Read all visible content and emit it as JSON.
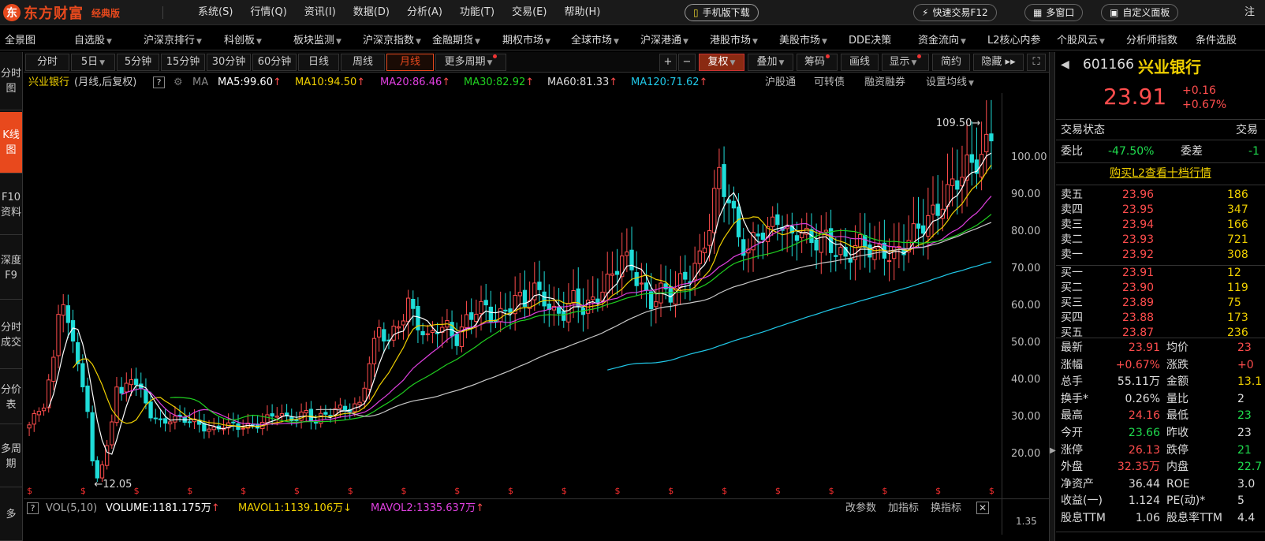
{
  "app": {
    "logo_text": "东方财富",
    "logo_sub": "经典版",
    "menu": [
      "系统(S)",
      "行情(Q)",
      "资讯(I)",
      "数据(D)",
      "分析(A)",
      "功能(T)",
      "交易(E)",
      "帮助(H)"
    ],
    "phone_btn": "手机版下载",
    "fast_trade_btn": "快速交易F12",
    "multi_window_btn": "多窗口",
    "custom_panel_btn": "自定义面板",
    "login": "注"
  },
  "nav": [
    {
      "label": "全景图",
      "dd": false
    },
    {
      "label": "自选股",
      "dd": true
    },
    {
      "label": "沪深京排行",
      "dd": true
    },
    {
      "label": "科创板",
      "dd": true
    },
    {
      "label": "板块监测",
      "dd": true
    },
    {
      "label": "沪深京指数",
      "dd": true
    },
    {
      "label": "金融期货",
      "dd": true
    },
    {
      "label": "期权市场",
      "dd": true
    },
    {
      "label": "全球市场",
      "dd": true
    },
    {
      "label": "沪深港通",
      "dd": true
    },
    {
      "label": "港股市场",
      "dd": true
    },
    {
      "label": "美股市场",
      "dd": true
    },
    {
      "label": "DDE决策",
      "dd": false
    },
    {
      "label": "资金流向",
      "dd": true
    },
    {
      "label": "L2核心内参",
      "dd": false
    },
    {
      "label": "个股风云",
      "dd": true
    },
    {
      "label": "分析师指数",
      "dd": false
    },
    {
      "label": "条件选股",
      "dd": false
    }
  ],
  "side_tabs": [
    {
      "label": "分时图",
      "active": false
    },
    {
      "label": "K线图",
      "active": true
    },
    {
      "label": "F10资料",
      "active": false
    },
    {
      "label": "深度F9",
      "active": false
    },
    {
      "label": "分时成交",
      "active": false
    },
    {
      "label": "分价表",
      "active": false
    },
    {
      "label": "多周期",
      "active": false
    },
    {
      "label": "多",
      "active": false
    }
  ],
  "periods": [
    {
      "label": "分时",
      "dd": false,
      "active": false
    },
    {
      "label": "5日",
      "dd": true,
      "active": false
    },
    {
      "label": "5分钟",
      "dd": false,
      "active": false
    },
    {
      "label": "15分钟",
      "dd": false,
      "active": false
    },
    {
      "label": "30分钟",
      "dd": false,
      "active": false
    },
    {
      "label": "60分钟",
      "dd": false,
      "active": false
    },
    {
      "label": "日线",
      "dd": false,
      "active": false
    },
    {
      "label": "周线",
      "dd": false,
      "active": false
    },
    {
      "label": "月线",
      "dd": false,
      "active": true
    },
    {
      "label": "更多周期",
      "dd": true,
      "active": false
    }
  ],
  "tools": {
    "plus": "+",
    "minus": "−",
    "fuquan": "复权",
    "overlay": "叠加",
    "chips": "筹码",
    "drawline": "画线",
    "display": "显示",
    "simple": "简约",
    "hide": "隐藏"
  },
  "indicators": {
    "stock_name": "兴业银行",
    "period_desc": "(月线,后复权)",
    "ma_label": "MA",
    "ma5": "MA5:99.60",
    "ma10": "MA10:94.50",
    "ma20": "MA20:86.46",
    "ma30": "MA30:82.92",
    "ma60": "MA60:81.33",
    "ma120": "MA120:71.62",
    "links": [
      "沪股通",
      "可转债",
      "融资融券"
    ],
    "setma": "设置均线"
  },
  "colors": {
    "up": "#ff4d4d",
    "down": "#1fdcd8",
    "ma5": "#ffffff",
    "ma10": "#f0d000",
    "ma20": "#e040e0",
    "ma30": "#20d020",
    "ma60": "#c8c8c8",
    "ma120": "#20c8e8",
    "accent": "#e8491d"
  },
  "chart_data": {
    "type": "candlestick",
    "title": "",
    "y_ticks": [
      20,
      30,
      40,
      50,
      60,
      70,
      80,
      90,
      100
    ],
    "ylim": [
      12,
      112
    ],
    "max_label": "109.50",
    "min_label": "12.05",
    "close_anchors": [
      [
        0,
        28
      ],
      [
        3,
        33
      ],
      [
        5,
        45
      ],
      [
        6,
        60
      ],
      [
        7,
        63
      ],
      [
        8,
        55
      ],
      [
        10,
        46
      ],
      [
        12,
        30
      ],
      [
        13,
        18
      ],
      [
        14,
        14
      ],
      [
        15,
        17
      ],
      [
        16,
        22
      ],
      [
        17,
        30
      ],
      [
        18,
        40
      ],
      [
        19,
        36
      ],
      [
        21,
        41
      ],
      [
        23,
        36
      ],
      [
        25,
        31
      ],
      [
        27,
        29
      ],
      [
        29,
        30
      ],
      [
        32,
        29
      ],
      [
        35,
        28
      ],
      [
        38,
        27
      ],
      [
        40,
        28
      ],
      [
        43,
        27
      ],
      [
        46,
        28
      ],
      [
        49,
        30
      ],
      [
        51,
        31
      ],
      [
        53,
        29
      ],
      [
        55,
        30
      ],
      [
        57,
        32
      ],
      [
        59,
        29
      ],
      [
        60,
        30
      ],
      [
        62,
        31
      ],
      [
        64,
        32
      ],
      [
        66,
        33
      ],
      [
        68,
        34
      ],
      [
        70,
        45
      ],
      [
        72,
        53
      ],
      [
        74,
        50
      ],
      [
        76,
        56
      ],
      [
        78,
        62
      ],
      [
        80,
        55
      ],
      [
        82,
        50
      ],
      [
        84,
        54
      ],
      [
        86,
        55
      ],
      [
        88,
        52
      ],
      [
        90,
        56
      ],
      [
        92,
        58
      ],
      [
        94,
        59
      ],
      [
        96,
        57
      ],
      [
        98,
        60
      ],
      [
        100,
        62
      ],
      [
        102,
        60
      ],
      [
        104,
        64
      ],
      [
        106,
        63
      ],
      [
        108,
        59
      ],
      [
        110,
        58
      ],
      [
        112,
        61
      ],
      [
        114,
        59
      ],
      [
        116,
        62
      ],
      [
        118,
        66
      ],
      [
        120,
        68
      ],
      [
        122,
        72
      ],
      [
        124,
        70
      ],
      [
        126,
        66
      ],
      [
        128,
        62
      ],
      [
        130,
        64
      ],
      [
        132,
        62
      ],
      [
        134,
        66
      ],
      [
        136,
        70
      ],
      [
        138,
        74
      ],
      [
        140,
        82
      ],
      [
        142,
        94
      ],
      [
        144,
        88
      ],
      [
        146,
        80
      ],
      [
        148,
        76
      ],
      [
        150,
        80
      ],
      [
        152,
        78
      ],
      [
        154,
        84
      ],
      [
        156,
        80
      ],
      [
        158,
        82
      ],
      [
        160,
        78
      ],
      [
        162,
        76
      ],
      [
        164,
        78
      ],
      [
        166,
        76
      ],
      [
        168,
        74
      ],
      [
        170,
        76
      ],
      [
        172,
        75
      ],
      [
        174,
        74
      ],
      [
        176,
        76
      ],
      [
        178,
        75
      ],
      [
        180,
        76
      ],
      [
        182,
        78
      ],
      [
        184,
        82
      ],
      [
        186,
        86
      ],
      [
        188,
        90
      ],
      [
        190,
        92
      ],
      [
        192,
        94
      ],
      [
        194,
        98
      ],
      [
        196,
        102
      ],
      [
        198,
        108
      ]
    ],
    "n_bars": 199,
    "ma_series": [
      "MA5",
      "MA10",
      "MA20",
      "MA30",
      "MA60",
      "MA120"
    ]
  },
  "volume": {
    "label": "VOL(5,10)",
    "volume": "VOLUME:1181.175万",
    "mavol1": "MAVOL1:1139.106万",
    "mavol2": "MAVOL2:1335.637万",
    "change_param": "改参数",
    "add_ind": "加指标",
    "swap_ind": "换指标",
    "tick": "1.35"
  },
  "quote": {
    "code": "601166",
    "name": "兴业银行",
    "price": "23.91",
    "change": "+0.16",
    "change_pct": "+0.67%",
    "status_label": "交易状态",
    "status_right": "交易",
    "weibi_label": "委比",
    "weibi_value": "-47.50%",
    "weicha_label": "委差",
    "weicha_value": "-1",
    "buy_l2": "购买L2查看十档行情",
    "asks": [
      {
        "label": "卖五",
        "price": "23.96",
        "vol": "186"
      },
      {
        "label": "卖四",
        "price": "23.95",
        "vol": "347"
      },
      {
        "label": "卖三",
        "price": "23.94",
        "vol": "166"
      },
      {
        "label": "卖二",
        "price": "23.93",
        "vol": "721"
      },
      {
        "label": "卖一",
        "price": "23.92",
        "vol": "308"
      }
    ],
    "bids": [
      {
        "label": "买一",
        "price": "23.91",
        "vol": "12"
      },
      {
        "label": "买二",
        "price": "23.90",
        "vol": "119"
      },
      {
        "label": "买三",
        "price": "23.89",
        "vol": "75"
      },
      {
        "label": "买四",
        "price": "23.88",
        "vol": "173"
      },
      {
        "label": "买五",
        "price": "23.87",
        "vol": "236"
      }
    ],
    "stats": [
      {
        "l1": "最新",
        "v1": "23.91",
        "c1": "red",
        "l2": "均价",
        "v2": "23",
        "c2": "red"
      },
      {
        "l1": "涨幅",
        "v1": "+0.67%",
        "c1": "red",
        "l2": "涨跌",
        "v2": "+0",
        "c2": "red"
      },
      {
        "l1": "总手",
        "v1": "55.11万",
        "c1": "wht",
        "l2": "金额",
        "v2": "13.1",
        "c2": "yel"
      },
      {
        "l1": "换手*",
        "v1": "0.26%",
        "c1": "wht",
        "l2": "量比",
        "v2": "2",
        "c2": "wht"
      },
      {
        "l1": "最高",
        "v1": "24.16",
        "c1": "red",
        "l2": "最低",
        "v2": "23",
        "c2": "grn"
      },
      {
        "l1": "今开",
        "v1": "23.66",
        "c1": "grn",
        "l2": "昨收",
        "v2": "23",
        "c2": "wht"
      },
      {
        "l1": "涨停",
        "v1": "26.13",
        "c1": "red",
        "l2": "跌停",
        "v2": "21",
        "c2": "grn"
      },
      {
        "l1": "外盘",
        "v1": "32.35万",
        "c1": "red",
        "l2": "内盘",
        "v2": "22.7",
        "c2": "grn"
      },
      {
        "l1": "净资产",
        "v1": "36.44",
        "c1": "wht",
        "l2": "ROE",
        "v2": "3.0",
        "c2": "wht"
      },
      {
        "l1": "收益(一)",
        "v1": "1.124",
        "c1": "wht",
        "l2": "PE(动)*",
        "v2": "5",
        "c2": "wht"
      },
      {
        "l1": "股息TTM",
        "v1": "1.06",
        "c1": "wht",
        "l2": "股息率TTM",
        "v2": "4.4",
        "c2": "wht"
      }
    ]
  }
}
